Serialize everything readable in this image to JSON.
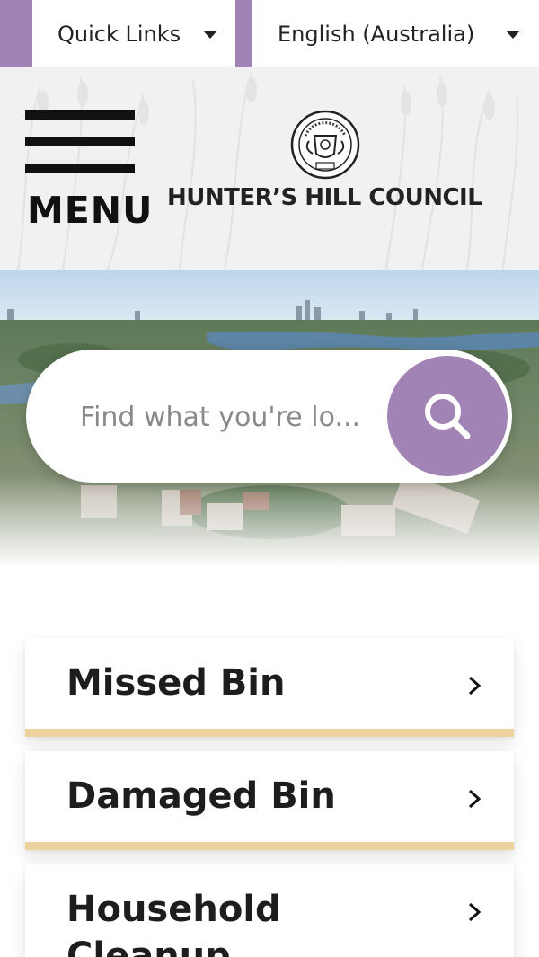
{
  "topbar": {
    "quick_links_label": "Quick Links",
    "language_label": "English (Australia)"
  },
  "header": {
    "menu_label": "MENU",
    "logo_text": "HUNTER’S HILL COUNCIL"
  },
  "search": {
    "placeholder": "Find what you're lo..."
  },
  "cards": [
    {
      "label": "Missed Bin"
    },
    {
      "label": "Damaged Bin"
    },
    {
      "label": "Household Cleanup"
    }
  ],
  "colors": {
    "accent_purple": "#a283b5",
    "card_underline": "#ecd29e",
    "header_bg": "#f1f1f1"
  },
  "icons": {
    "dropdown": "caret-down-icon",
    "search": "search-icon",
    "chevron": "chevron-right-icon",
    "menu": "hamburger-icon"
  }
}
